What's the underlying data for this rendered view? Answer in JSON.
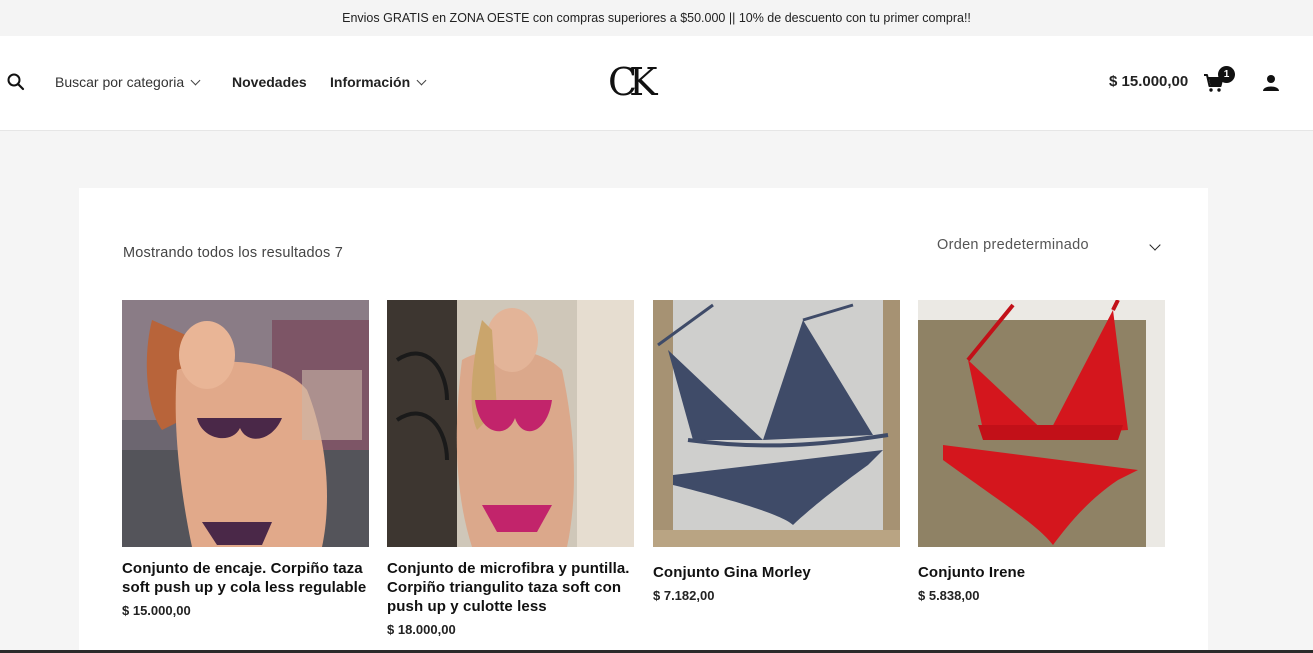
{
  "announcement": "Envios GRATIS en ZONA OESTE con compras superiores a $50.000 || 10% de descuento con tu primer compra!!",
  "nav": {
    "category": "Buscar por categoria",
    "news": "Novedades",
    "info": "Información"
  },
  "logo": "CK",
  "cart": {
    "total": "$ 15.000,00",
    "count": "1"
  },
  "shop": {
    "results": "Mostrando todos los resultados 7",
    "orderby": "Orden predeterminado"
  },
  "products": [
    {
      "title": "Conjunto de encaje. Corpiño taza soft push up y cola less regulable",
      "price": "$ 15.000,00"
    },
    {
      "title": "Conjunto de microfibra y puntilla. Corpiño triangulito taza soft con push up y culotte less",
      "price": "$ 18.000,00"
    },
    {
      "title": "Conjunto Gina Morley",
      "price": "$ 7.182,00"
    },
    {
      "title": "Conjunto Irene",
      "price": "$ 5.838,00"
    }
  ],
  "colors": {
    "accent": "#111111",
    "background": "#f5f5f5",
    "panel": "#ffffff"
  }
}
